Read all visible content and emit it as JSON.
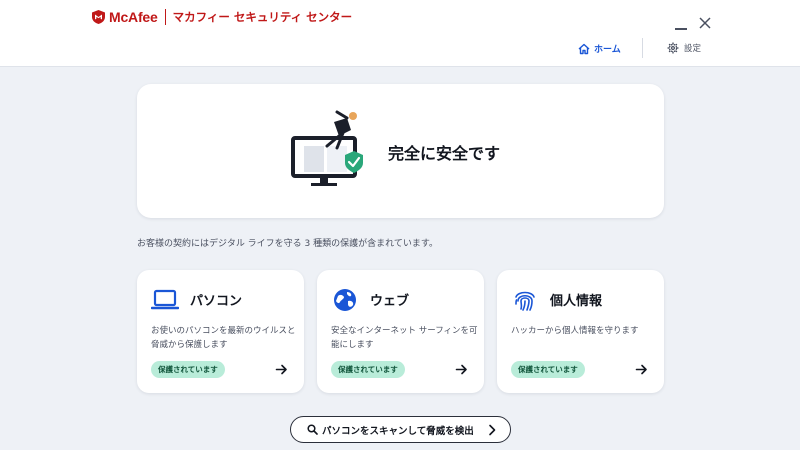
{
  "header": {
    "logo_text": "McAfee",
    "product_name": "マカフィー セキュリティ センター",
    "nav_home_label": "ホーム",
    "nav_settings_label": "設定"
  },
  "status": {
    "title": "完全に安全です"
  },
  "subscription_note": "お客様の契約にはデジタル ライフを守る 3 種類の保護が含まれています。",
  "features": [
    {
      "title": "パソコン",
      "description": "お使いのパソコンを最新のウイルスと脅威から保護します",
      "badge": "保護されています"
    },
    {
      "title": "ウェブ",
      "description": "安全なインターネット サーフィンを可能にします",
      "badge": "保護されています"
    },
    {
      "title": "個人情報",
      "description": "ハッカーから個人情報を守ります",
      "badge": "保護されています"
    }
  ],
  "scan_button": {
    "label": "パソコンをスキャンして脅威を検出"
  },
  "colors": {
    "brand": "#c01818",
    "accent": "#1a56d6",
    "protected_badge": "#b9ecd9",
    "shield_green": "#2aa77a"
  },
  "icons": {
    "home": "home-icon",
    "settings": "gear-icon",
    "pc": "laptop-icon",
    "web": "globe-icon",
    "identity": "fingerprint-icon",
    "arrow": "arrow-right-icon",
    "search": "search-icon"
  }
}
